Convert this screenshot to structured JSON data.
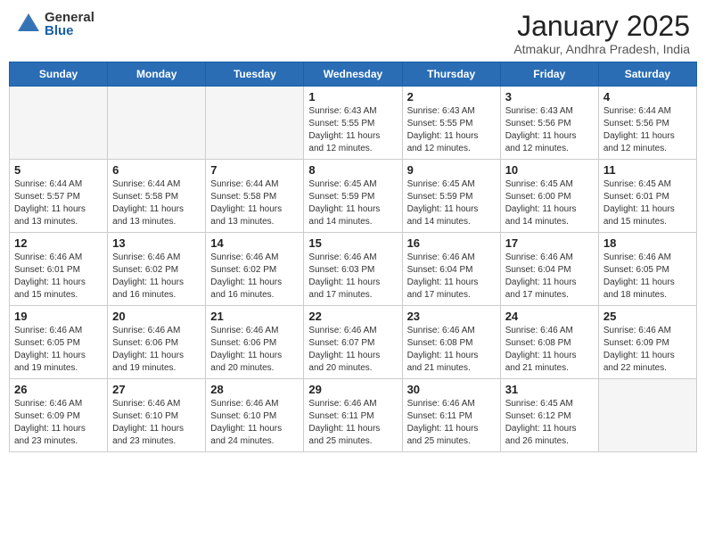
{
  "header": {
    "logo_general": "General",
    "logo_blue": "Blue",
    "month_title": "January 2025",
    "location": "Atmakur, Andhra Pradesh, India"
  },
  "days_of_week": [
    "Sunday",
    "Monday",
    "Tuesday",
    "Wednesday",
    "Thursday",
    "Friday",
    "Saturday"
  ],
  "weeks": [
    [
      {
        "day": "",
        "info": ""
      },
      {
        "day": "",
        "info": ""
      },
      {
        "day": "",
        "info": ""
      },
      {
        "day": "1",
        "info": "Sunrise: 6:43 AM\nSunset: 5:55 PM\nDaylight: 11 hours and 12 minutes."
      },
      {
        "day": "2",
        "info": "Sunrise: 6:43 AM\nSunset: 5:55 PM\nDaylight: 11 hours and 12 minutes."
      },
      {
        "day": "3",
        "info": "Sunrise: 6:43 AM\nSunset: 5:56 PM\nDaylight: 11 hours and 12 minutes."
      },
      {
        "day": "4",
        "info": "Sunrise: 6:44 AM\nSunset: 5:56 PM\nDaylight: 11 hours and 12 minutes."
      }
    ],
    [
      {
        "day": "5",
        "info": "Sunrise: 6:44 AM\nSunset: 5:57 PM\nDaylight: 11 hours and 13 minutes."
      },
      {
        "day": "6",
        "info": "Sunrise: 6:44 AM\nSunset: 5:58 PM\nDaylight: 11 hours and 13 minutes."
      },
      {
        "day": "7",
        "info": "Sunrise: 6:44 AM\nSunset: 5:58 PM\nDaylight: 11 hours and 13 minutes."
      },
      {
        "day": "8",
        "info": "Sunrise: 6:45 AM\nSunset: 5:59 PM\nDaylight: 11 hours and 14 minutes."
      },
      {
        "day": "9",
        "info": "Sunrise: 6:45 AM\nSunset: 5:59 PM\nDaylight: 11 hours and 14 minutes."
      },
      {
        "day": "10",
        "info": "Sunrise: 6:45 AM\nSunset: 6:00 PM\nDaylight: 11 hours and 14 minutes."
      },
      {
        "day": "11",
        "info": "Sunrise: 6:45 AM\nSunset: 6:01 PM\nDaylight: 11 hours and 15 minutes."
      }
    ],
    [
      {
        "day": "12",
        "info": "Sunrise: 6:46 AM\nSunset: 6:01 PM\nDaylight: 11 hours and 15 minutes."
      },
      {
        "day": "13",
        "info": "Sunrise: 6:46 AM\nSunset: 6:02 PM\nDaylight: 11 hours and 16 minutes."
      },
      {
        "day": "14",
        "info": "Sunrise: 6:46 AM\nSunset: 6:02 PM\nDaylight: 11 hours and 16 minutes."
      },
      {
        "day": "15",
        "info": "Sunrise: 6:46 AM\nSunset: 6:03 PM\nDaylight: 11 hours and 17 minutes."
      },
      {
        "day": "16",
        "info": "Sunrise: 6:46 AM\nSunset: 6:04 PM\nDaylight: 11 hours and 17 minutes."
      },
      {
        "day": "17",
        "info": "Sunrise: 6:46 AM\nSunset: 6:04 PM\nDaylight: 11 hours and 17 minutes."
      },
      {
        "day": "18",
        "info": "Sunrise: 6:46 AM\nSunset: 6:05 PM\nDaylight: 11 hours and 18 minutes."
      }
    ],
    [
      {
        "day": "19",
        "info": "Sunrise: 6:46 AM\nSunset: 6:05 PM\nDaylight: 11 hours and 19 minutes."
      },
      {
        "day": "20",
        "info": "Sunrise: 6:46 AM\nSunset: 6:06 PM\nDaylight: 11 hours and 19 minutes."
      },
      {
        "day": "21",
        "info": "Sunrise: 6:46 AM\nSunset: 6:06 PM\nDaylight: 11 hours and 20 minutes."
      },
      {
        "day": "22",
        "info": "Sunrise: 6:46 AM\nSunset: 6:07 PM\nDaylight: 11 hours and 20 minutes."
      },
      {
        "day": "23",
        "info": "Sunrise: 6:46 AM\nSunset: 6:08 PM\nDaylight: 11 hours and 21 minutes."
      },
      {
        "day": "24",
        "info": "Sunrise: 6:46 AM\nSunset: 6:08 PM\nDaylight: 11 hours and 21 minutes."
      },
      {
        "day": "25",
        "info": "Sunrise: 6:46 AM\nSunset: 6:09 PM\nDaylight: 11 hours and 22 minutes."
      }
    ],
    [
      {
        "day": "26",
        "info": "Sunrise: 6:46 AM\nSunset: 6:09 PM\nDaylight: 11 hours and 23 minutes."
      },
      {
        "day": "27",
        "info": "Sunrise: 6:46 AM\nSunset: 6:10 PM\nDaylight: 11 hours and 23 minutes."
      },
      {
        "day": "28",
        "info": "Sunrise: 6:46 AM\nSunset: 6:10 PM\nDaylight: 11 hours and 24 minutes."
      },
      {
        "day": "29",
        "info": "Sunrise: 6:46 AM\nSunset: 6:11 PM\nDaylight: 11 hours and 25 minutes."
      },
      {
        "day": "30",
        "info": "Sunrise: 6:46 AM\nSunset: 6:11 PM\nDaylight: 11 hours and 25 minutes."
      },
      {
        "day": "31",
        "info": "Sunrise: 6:45 AM\nSunset: 6:12 PM\nDaylight: 11 hours and 26 minutes."
      },
      {
        "day": "",
        "info": ""
      }
    ]
  ]
}
